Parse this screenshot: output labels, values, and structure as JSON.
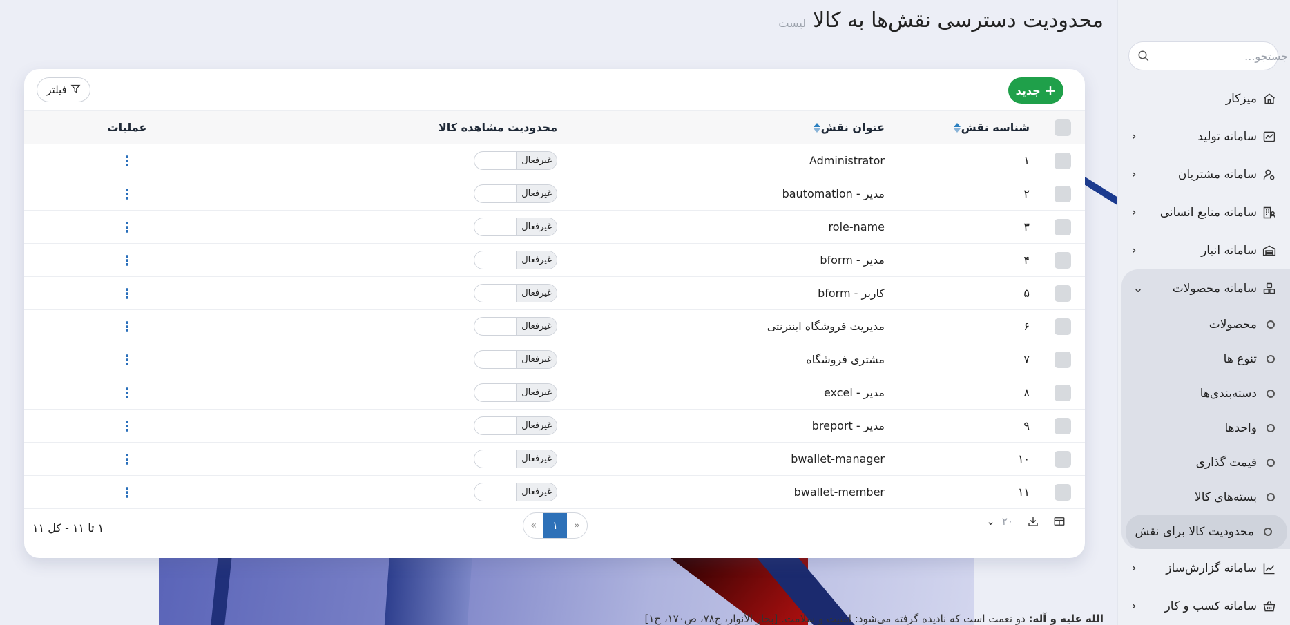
{
  "page": {
    "title": "محدودیت دسترسی نقش‌ها به کالا",
    "subtitle": "لیست"
  },
  "search": {
    "placeholder": "جستجو..."
  },
  "sidebar": {
    "items": [
      {
        "label": "میزکار",
        "icon": "home-icon",
        "chevron": false
      },
      {
        "label": "سامانه تولید",
        "icon": "chart-board-icon",
        "chevron": true
      },
      {
        "label": "سامانه مشتریان",
        "icon": "user-gear-icon",
        "chevron": true
      },
      {
        "label": "سامانه منابع انسانی",
        "icon": "building-user-icon",
        "chevron": true
      },
      {
        "label": "سامانه انبار",
        "icon": "warehouse-icon",
        "chevron": true
      },
      {
        "label": "سامانه محصولات",
        "icon": "boxes-icon",
        "chevron": true
      }
    ],
    "products_sub": [
      {
        "label": "محصولات"
      },
      {
        "label": "تنوع ها"
      },
      {
        "label": "دسته‌بندی‌ها"
      },
      {
        "label": "واحدها"
      },
      {
        "label": "قیمت گذاری"
      },
      {
        "label": "بسته‌های کالا"
      },
      {
        "label": "محدودیت کالا برای نقش"
      }
    ],
    "items_after": [
      {
        "label": "سامانه گزارش‌ساز",
        "icon": "line-chart-icon",
        "chevron": true
      },
      {
        "label": "سامانه کسب و کار",
        "icon": "basket-icon",
        "chevron": true
      }
    ]
  },
  "toolbar": {
    "new_label": "جدید",
    "filter_label": "فیلتر"
  },
  "table": {
    "headers": {
      "id": "شناسه نقش",
      "title": "عنوان نقش",
      "limit": "محدودیت مشاهده کالا",
      "ops": "عملیات"
    },
    "rows": [
      {
        "id": "۱",
        "title": "Administrator",
        "status": "غیرفعال"
      },
      {
        "id": "۲",
        "title": "مدیر - bautomation",
        "status": "غیرفعال"
      },
      {
        "id": "۳",
        "title": "role-name",
        "status": "غیرفعال"
      },
      {
        "id": "۴",
        "title": "مدیر - bform",
        "status": "غیرفعال"
      },
      {
        "id": "۵",
        "title": "کاربر - bform",
        "status": "غیرفعال"
      },
      {
        "id": "۶",
        "title": "مدیریت فروشگاه اینترنتی",
        "status": "غیرفعال"
      },
      {
        "id": "۷",
        "title": "مشتری فروشگاه",
        "status": "غیرفعال"
      },
      {
        "id": "۸",
        "title": "مدیر - excel",
        "status": "غیرفعال"
      },
      {
        "id": "۹",
        "title": "مدیر - breport",
        "status": "غیرفعال"
      },
      {
        "id": "۱۰",
        "title": "bwallet-manager",
        "status": "غیرفعال"
      },
      {
        "id": "۱۱",
        "title": "bwallet-member",
        "status": "غیرفعال"
      }
    ]
  },
  "footer": {
    "count_text": "۱ تا ۱۱ - کل ۱۱",
    "current_page": "۱",
    "page_size": "۲۰",
    "prev": "»",
    "next": "«"
  },
  "bottom_note": {
    "bold": "الله علیه و آله:",
    "text": " دو نعمت است که نادیده گرفته می‌شود: امنیت و سلامت. [بحار الأنوار، ج۷۸، ص۱۷۰، ح۱]"
  },
  "colors": {
    "accent_green": "#1fa04a",
    "accent_blue": "#2e71b8"
  }
}
